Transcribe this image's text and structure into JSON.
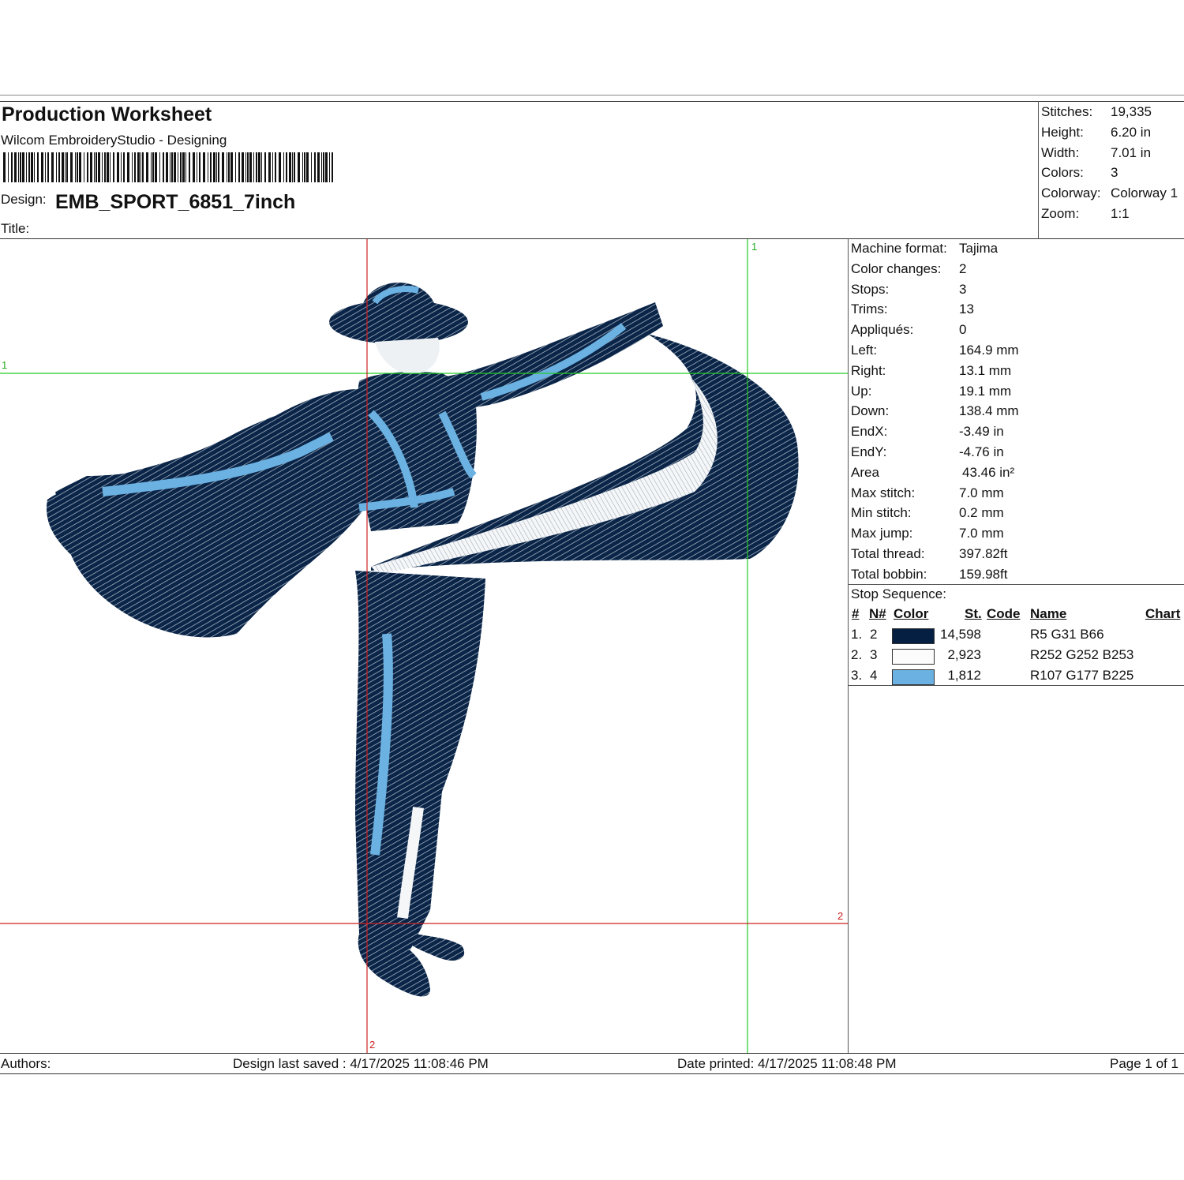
{
  "header": {
    "title": "Production Worksheet",
    "software": "Wilcom EmbroideryStudio - Designing",
    "design_label": "Design:",
    "design_name": "EMB_SPORT_6851_7inch",
    "title_label": "Title:"
  },
  "summary": [
    {
      "label": "Stitches:",
      "value": "19,335"
    },
    {
      "label": "Height:",
      "value": "6.20 in"
    },
    {
      "label": "Width:",
      "value": "7.01 in"
    },
    {
      "label": "Colors:",
      "value": "3"
    },
    {
      "label": "Colorway:",
      "value": "Colorway 1"
    },
    {
      "label": "Zoom:",
      "value": "1:1"
    }
  ],
  "details": [
    {
      "label": "Machine format:",
      "value": "Tajima"
    },
    {
      "label": "Color changes:",
      "value": "2"
    },
    {
      "label": "Stops:",
      "value": "3"
    },
    {
      "label": "Trims:",
      "value": "13"
    },
    {
      "label": "Appliqués:",
      "value": "0"
    },
    {
      "label": "Left:",
      "value": "164.9 mm"
    },
    {
      "label": "Right:",
      "value": "13.1 mm"
    },
    {
      "label": "Up:",
      "value": "19.1 mm"
    },
    {
      "label": "Down:",
      "value": "138.4 mm"
    },
    {
      "label": "EndX:",
      "value": "-3.49 in"
    },
    {
      "label": "EndY:",
      "value": "-4.76 in"
    },
    {
      "label": "Area",
      "value": "43.46 in²"
    },
    {
      "label": "Max stitch:",
      "value": "7.0 mm"
    },
    {
      "label": "Min stitch:",
      "value": "0.2 mm"
    },
    {
      "label": "Max jump:",
      "value": "7.0 mm"
    },
    {
      "label": "Total thread:",
      "value": "397.82ft"
    },
    {
      "label": "Total bobbin:",
      "value": "159.98ft"
    }
  ],
  "stop_sequence": {
    "label": "Stop Sequence:",
    "headers": {
      "num": "#",
      "needle": "N#",
      "color": "Color",
      "stitches": "St.",
      "code": "Code",
      "name": "Name",
      "chart": "Chart"
    },
    "rows": [
      {
        "num": "1.",
        "needle": "2",
        "swatch": "#051f42",
        "stitches": "14,598",
        "name": "R5 G31 B66"
      },
      {
        "num": "2.",
        "needle": "3",
        "swatch": "#fcfcfd",
        "stitches": "2,923",
        "name": "R252 G252 B253"
      },
      {
        "num": "3.",
        "needle": "4",
        "swatch": "#6bb1e1",
        "stitches": "1,812",
        "name": "R107 G177 B225"
      }
    ]
  },
  "guides": {
    "h1": "1",
    "v1": "1",
    "h2": "2",
    "v2": "2"
  },
  "footer": {
    "authors": "Authors:",
    "saved": "Design last saved : 4/17/2025 11:08:46 PM",
    "printed": "Date printed: 4/17/2025 11:08:48 PM",
    "page": "Page 1 of 1"
  },
  "colors": {
    "navy": "#051f42",
    "blue": "#6bb1e1",
    "red_guide": "#cc2222",
    "green_guide": "#22cc22"
  }
}
